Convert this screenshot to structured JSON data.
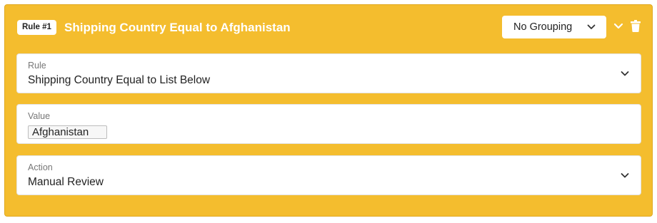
{
  "rule": {
    "badge": "Rule #1",
    "title": "Shipping Country Equal to Afghanistan",
    "grouping": {
      "selected": "No Grouping",
      "icon": "chevron-down-icon"
    },
    "collapse_icon": "chevron-down-icon",
    "delete_icon": "trash-icon",
    "colors": {
      "card_background": "#f4bd2e",
      "title_text": "#ffffff",
      "field_background": "#ffffff",
      "label_text": "#777777"
    }
  },
  "fields": {
    "rule": {
      "label": "Rule",
      "value": "Shipping Country Equal to List Below"
    },
    "value": {
      "label": "Value",
      "tags": [
        "Afghanistan"
      ]
    },
    "action": {
      "label": "Action",
      "value": "Manual Review"
    }
  }
}
